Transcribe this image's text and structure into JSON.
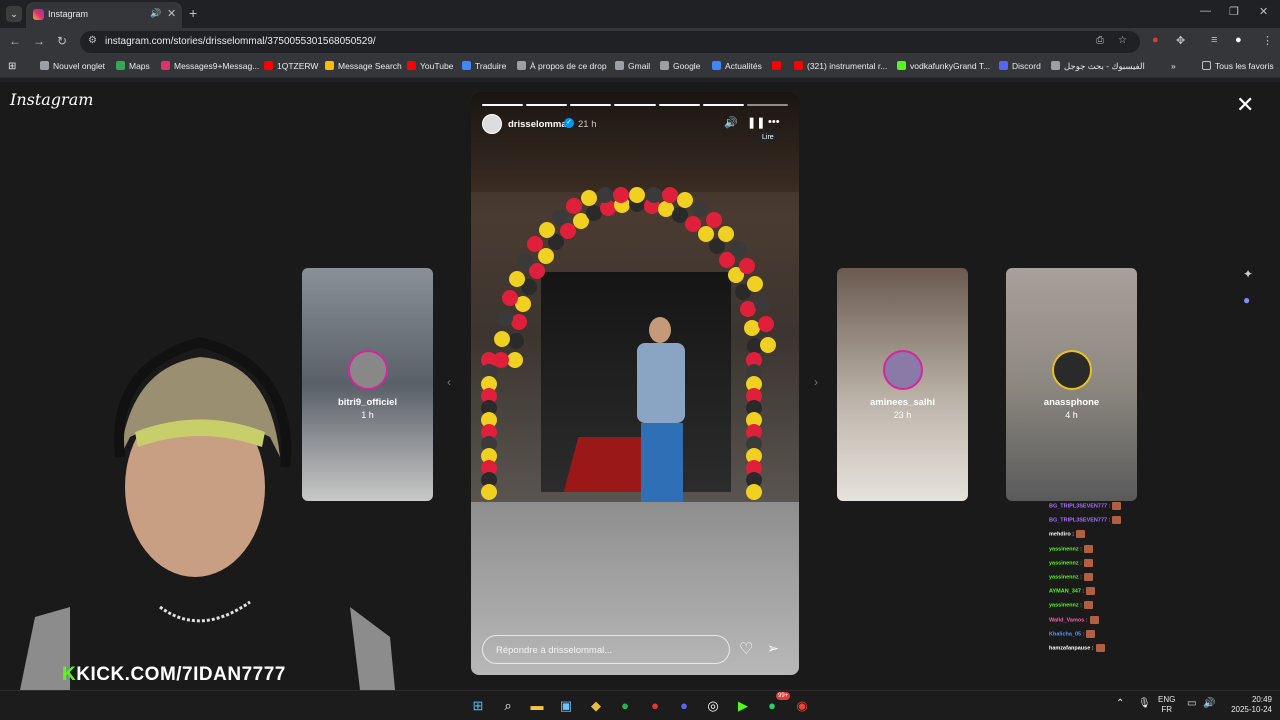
{
  "tab": {
    "title": "Instagram",
    "audio_icon": "speaker-icon",
    "close_glyph": "✕",
    "new_tab_glyph": "+",
    "menu_glyph": "⌄"
  },
  "window": {
    "minimize": "—",
    "maximize": "❐",
    "close": "✕"
  },
  "nav": {
    "back": "←",
    "forward": "→",
    "reload": "↻"
  },
  "address_bar": {
    "url": "instagram.com/stories/drisselommal/3750055301568050529/"
  },
  "bookmarks": [
    {
      "label": "Nouvel onglet",
      "color": "#9aa0a6"
    },
    {
      "label": "Maps",
      "color": "#34a853"
    },
    {
      "label": "Messages9+Messag...",
      "color": "#e1306c"
    },
    {
      "label": "1QTZERW",
      "color": "#ff0000"
    },
    {
      "label": "Message Search",
      "color": "#fbbc04"
    },
    {
      "label": "YouTube",
      "color": "#ff0000"
    },
    {
      "label": "Traduire",
      "color": "#4285f4"
    },
    {
      "label": "À propos de ce drop",
      "color": "#9aa0a6"
    },
    {
      "label": "Gmail",
      "color": "#9aa0a6"
    },
    {
      "label": "Google",
      "color": "#9aa0a6"
    },
    {
      "label": "Actualités",
      "color": "#4285f4"
    },
    {
      "label": "",
      "color": "#ff0000"
    },
    {
      "label": "(321) instrumental r...",
      "color": "#ff0000"
    },
    {
      "label": "vodkafunkyGrand T...",
      "color": "#53fc18"
    },
    {
      "label": "Discord",
      "color": "#5865f2"
    },
    {
      "label": "الفيسبوك - بحث جوجل",
      "color": "#9aa0a6"
    }
  ],
  "bookmarks_more": "»",
  "all_favorites": "Tous les favoris",
  "instagram_logo": "Instagram",
  "story": {
    "username": "drisselommal",
    "time": "21 h",
    "tooltip": "Lire",
    "reply_placeholder": "Répondre à drisselommal...",
    "segments_done": 6,
    "segments_total": 7
  },
  "side_stories": [
    {
      "name": "bitri9_officiel",
      "ago": "1 h"
    },
    {
      "name": "aminees_salhi",
      "ago": "23 h"
    },
    {
      "name": "anassphone",
      "ago": "4 h"
    }
  ],
  "overlay": {
    "kick_prefix": "K",
    "kick_text": "KICK.COM/7IDAN7777"
  },
  "chat": [
    {
      "user": "BG_TRIPL3SEVEN777 :",
      "color": "#a970ff"
    },
    {
      "user": "BG_TRIPL3SEVEN777 :",
      "color": "#a970ff"
    },
    {
      "user": "mehdiro :",
      "color": "#ffffff"
    },
    {
      "user": "yassinennz :",
      "color": "#53fc18"
    },
    {
      "user": "yassinennz :",
      "color": "#53fc18"
    },
    {
      "user": "yassinennz :",
      "color": "#53fc18"
    },
    {
      "user": "AYMAN_347 :",
      "color": "#53fc18"
    },
    {
      "user": "yassinennz :",
      "color": "#53fc18"
    },
    {
      "user": "Walid_Vamos :",
      "color": "#ff5fb0"
    },
    {
      "user": "Khalicha_05 :",
      "color": "#4d9bff"
    },
    {
      "user": "hamzafanpause :",
      "color": "#ffffff"
    }
  ],
  "tray": {
    "lang_top": "ENG",
    "lang_bottom": "FR",
    "time": "20:49",
    "date": "2025-10-24",
    "notif_badge": "99+"
  }
}
